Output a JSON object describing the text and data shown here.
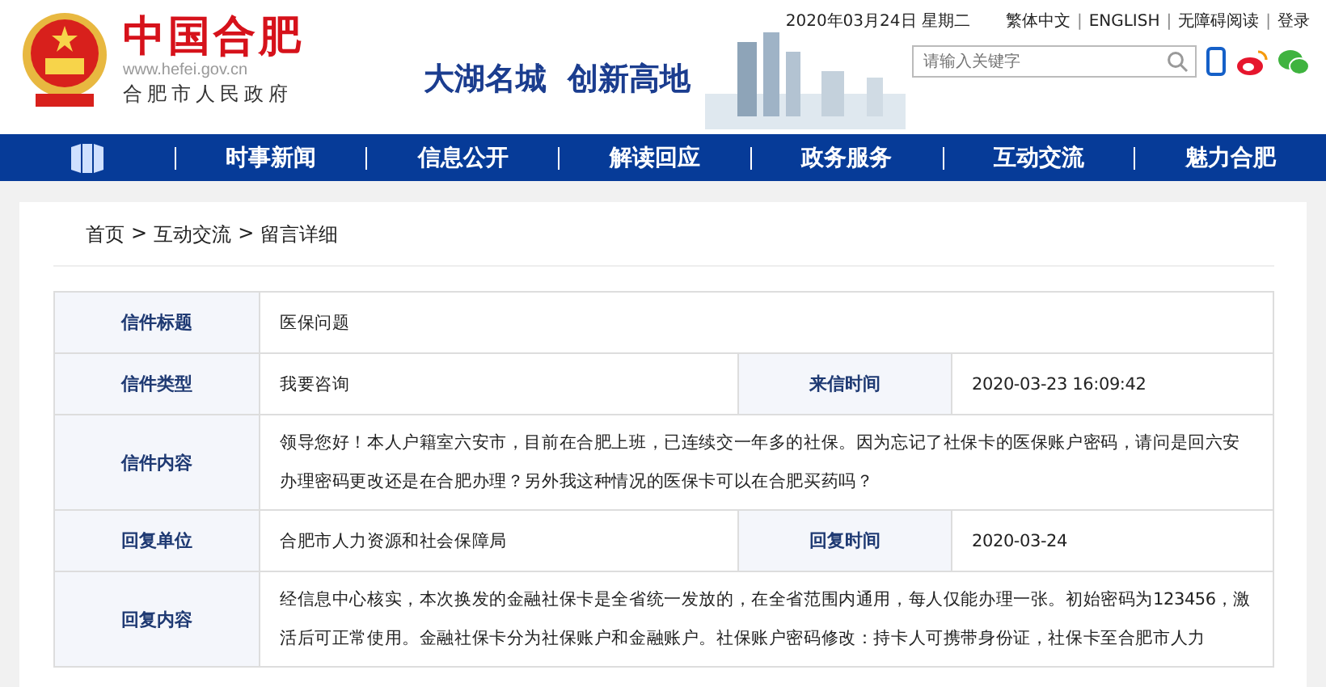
{
  "header": {
    "site_title": "中国合肥",
    "site_url": "www.hefei.gov.cn",
    "site_subtitle": "合肥市人民政府",
    "slogan": "大湖名城  创新高地",
    "date": "2020年03月24日 星期二",
    "links": [
      "繁体中文",
      "ENGLISH",
      "无障碍阅读",
      "登录"
    ],
    "link_separator": "|",
    "search": {
      "placeholder": "请输入关键字"
    }
  },
  "nav": {
    "items": [
      {
        "label": "时事新闻",
        "selected": false
      },
      {
        "label": "信息公开",
        "selected": false
      },
      {
        "label": "解读回应",
        "selected": false
      },
      {
        "label": "政务服务",
        "selected": false
      },
      {
        "label": "互动交流",
        "selected": false
      },
      {
        "label": "魅力合肥",
        "selected": false
      }
    ]
  },
  "breadcrumb": [
    "首页",
    "互动交流",
    "留言详细"
  ],
  "breadcrumb_separator": ">",
  "table": {
    "rows": [
      {
        "kind": "single",
        "label": "信件标题",
        "value": "医保问题"
      },
      {
        "kind": "pair",
        "label": "信件类型",
        "value": "我要咨询",
        "label_2": "来信时间",
        "value_2": "2020-03-23 16:09:42"
      },
      {
        "kind": "single",
        "label": "信件内容",
        "value": "领导您好！本人户籍室六安市，目前在合肥上班，已连续交一年多的社保。因为忘记了社保卡的医保账户密码，请问是回六安办理密码更改还是在合肥办理？另外我这种情况的医保卡可以在合肥买药吗？"
      },
      {
        "kind": "pair",
        "label": "回复单位",
        "value": "合肥市人力资源和社会保障局",
        "label_2": "回复时间",
        "value_2": "2020-03-24"
      },
      {
        "kind": "single",
        "label": "回复内容",
        "value": "经信息中心核实，本次换发的金融社保卡是全省统一发放的，在全省范围内通用，每人仅能办理一张。初始密码为123456，激活后可正常使用。金融社保卡分为社保账户和金融账户。社保账户密码修改：持卡人可携带身份证，社保卡至合肥市人力"
      }
    ]
  }
}
